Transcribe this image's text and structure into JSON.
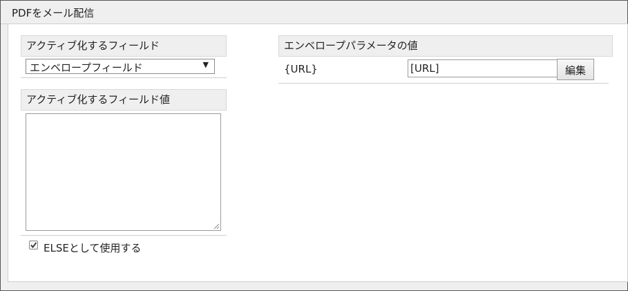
{
  "window": {
    "title": "PDFをメール配信"
  },
  "left": {
    "field_header": "アクティブ化するフィールド",
    "field_select_value": "エンベロープフィールド",
    "value_header": "アクティブ化するフィールド値",
    "value_text": "",
    "else_checkbox": {
      "label": "ELSEとして使用する",
      "checked": true
    }
  },
  "right": {
    "params_header": "エンベロープパラメータの値",
    "params": [
      {
        "key": "{URL}",
        "value": "[URL]",
        "button_label": "編集"
      }
    ]
  },
  "icons": {
    "select_arrow": "caret-down-icon",
    "checkmark": "checkmark-icon",
    "resize": "resize-grip-icon"
  }
}
